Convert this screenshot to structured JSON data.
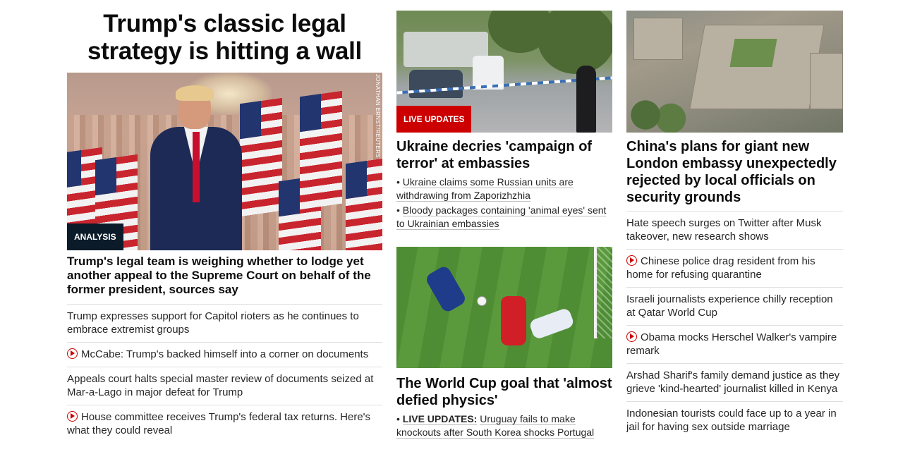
{
  "col1": {
    "banner": "Trump's classic legal strategy is hitting a wall",
    "image_credit": "JONATHAN ERNST/REUTERS",
    "tag": "ANALYSIS",
    "headline": "Trump's legal team is weighing whether to lodge yet another appeal to the Supreme Court on behalf of the former president, sources say",
    "items": [
      {
        "text": "Trump expresses support for Capitol rioters as he continues to embrace extremist groups",
        "video": false
      },
      {
        "text": "McCabe: Trump's backed himself into a corner on documents",
        "video": true
      },
      {
        "text": "Appeals court halts special master review of documents seized at Mar-a-Lago in major defeat for Trump",
        "video": false
      },
      {
        "text": "House committee receives Trump's federal tax returns. Here's what they could reveal",
        "video": true
      }
    ]
  },
  "col2": {
    "card1": {
      "tag": "LIVE UPDATES",
      "headline": "Ukraine decries 'campaign of terror' at embassies",
      "bullets": [
        "Ukraine claims some Russian units are withdrawing from Zaporizhzhia",
        "Bloody packages containing 'animal eyes' sent to Ukrainian embassies"
      ]
    },
    "card2": {
      "headline": "The World Cup goal that 'almost defied physics'",
      "bullet_label": "LIVE UPDATES:",
      "bullet_text": "Uruguay fails to make knockouts after South Korea shocks Portugal"
    }
  },
  "col3": {
    "headline": "China's plans for giant new London embassy unexpectedly rejected by local officials on security grounds",
    "items": [
      {
        "text": "Hate speech surges on Twitter after Musk takeover, new research shows",
        "video": false
      },
      {
        "text": "Chinese police drag resident from his home for refusing quarantine",
        "video": true
      },
      {
        "text": "Israeli journalists experience chilly reception at Qatar World Cup",
        "video": false
      },
      {
        "text": "Obama mocks Herschel Walker's vampire remark",
        "video": true
      },
      {
        "text": "Arshad Sharif's family demand justice as they grieve 'kind-hearted' journalist killed in Kenya",
        "video": false
      },
      {
        "text": "Indonesian tourists could face up to a year in jail for having sex outside marriage",
        "video": false
      }
    ]
  },
  "colors": {
    "accent_red": "#cc0000",
    "analysis_bg": "#0c1b29",
    "text": "#0c0c0c"
  }
}
